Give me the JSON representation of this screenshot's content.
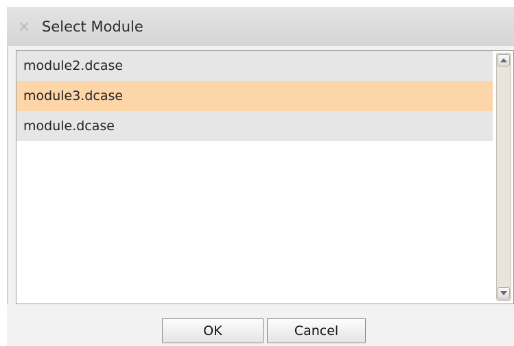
{
  "dialog": {
    "title": "Select Module",
    "icon": "close-icon"
  },
  "list": {
    "items": [
      {
        "label": "module2.dcase",
        "selected": false
      },
      {
        "label": "module3.dcase",
        "selected": true
      },
      {
        "label": "module.dcase",
        "selected": false
      }
    ]
  },
  "buttons": {
    "ok_label": "OK",
    "cancel_label": "Cancel"
  },
  "colors": {
    "selection": "#fcd6a8",
    "item_background": "#e6e6e6"
  }
}
